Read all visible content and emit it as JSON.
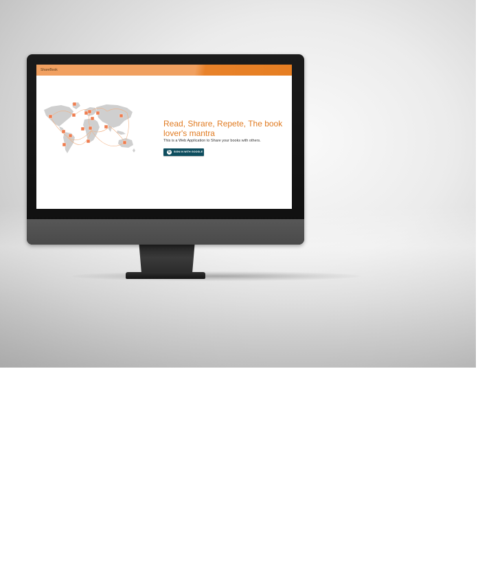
{
  "app": {
    "title": "ShareBook",
    "accent_color": "#e67e22",
    "bar_color_light": "#f0a060"
  },
  "hero": {
    "headline": "Read, Shrare, Repete, The book lover's mantra",
    "subtitle": "This is a Web Application to Share your books with others.",
    "signin_label": "SIGN IN WITH GOOGLE",
    "signin_icon": "google-g-icon",
    "signin_color": "#0d4d5e",
    "illustration": "world-map-book-network"
  }
}
